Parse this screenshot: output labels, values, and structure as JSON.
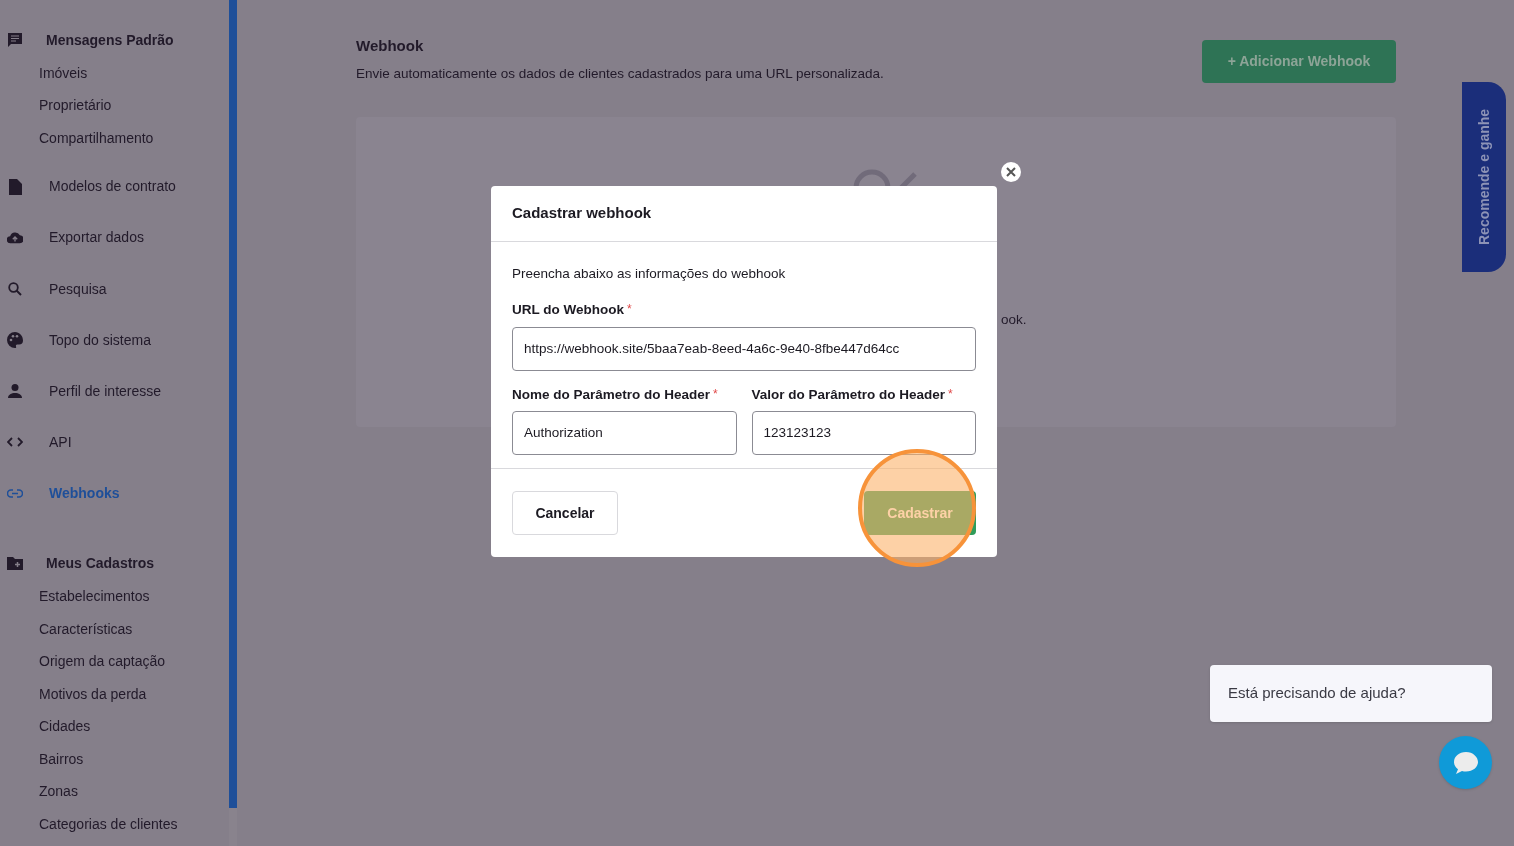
{
  "sidebar": {
    "items": [
      {
        "label": "Mensagens Padrão",
        "kind": "group",
        "selected": false,
        "children": [
          {
            "label": "Imóveis",
            "selected": false
          },
          {
            "label": "Proprietário",
            "selected": false
          },
          {
            "label": "Compartilhamento",
            "selected": false
          }
        ]
      },
      {
        "label": "Modelos de contrato",
        "kind": "item",
        "selected": false
      },
      {
        "label": "Exportar dados",
        "kind": "item",
        "selected": false
      },
      {
        "label": "Pesquisa",
        "kind": "item",
        "selected": false
      },
      {
        "label": "Topo do sistema",
        "kind": "item",
        "selected": false
      },
      {
        "label": "Perfil de interesse",
        "kind": "item",
        "selected": false
      },
      {
        "label": "API",
        "kind": "item",
        "selected": false
      },
      {
        "label": "Webhooks",
        "kind": "item",
        "selected": true
      },
      {
        "label": "Meus Cadastros",
        "kind": "group",
        "selected": false,
        "children": [
          {
            "label": "Estabelecimentos",
            "selected": false
          },
          {
            "label": "Características",
            "selected": false
          },
          {
            "label": "Origem da captação",
            "selected": false
          },
          {
            "label": "Motivos da perda",
            "selected": false
          },
          {
            "label": "Cidades",
            "selected": false
          },
          {
            "label": "Bairros",
            "selected": false
          },
          {
            "label": "Zonas",
            "selected": false
          },
          {
            "label": "Categorias de clientes",
            "selected": false
          }
        ]
      }
    ]
  },
  "page": {
    "title": "Webhook",
    "subtitle": "Envie automaticamente os dados de clientes cadastrados para uma URL personalizada.",
    "add_button": "+ Adicionar Webhook",
    "empty_card_text": "ook."
  },
  "modal": {
    "title": "Cadastrar webhook",
    "intro": "Preencha abaixo as informações do webhook",
    "fields": [
      {
        "label": "URL do Webhook",
        "required_mark": "*",
        "value": "https://webhook.site/5baa7eab-8eed-4a6c-9e40-8fbe447d64cc"
      },
      {
        "label": "Nome do Parâmetro do Header",
        "required_mark": "*",
        "value": "Authorization"
      },
      {
        "label": "Valor do Parâmetro do Header",
        "required_mark": "*",
        "value": "123123123"
      }
    ],
    "cancel_button": "Cancelar",
    "submit_button": "Cadastrar"
  },
  "referral_tab": "Recomende e ganhe",
  "help_bubble": "Está precisando de ajuda?"
}
